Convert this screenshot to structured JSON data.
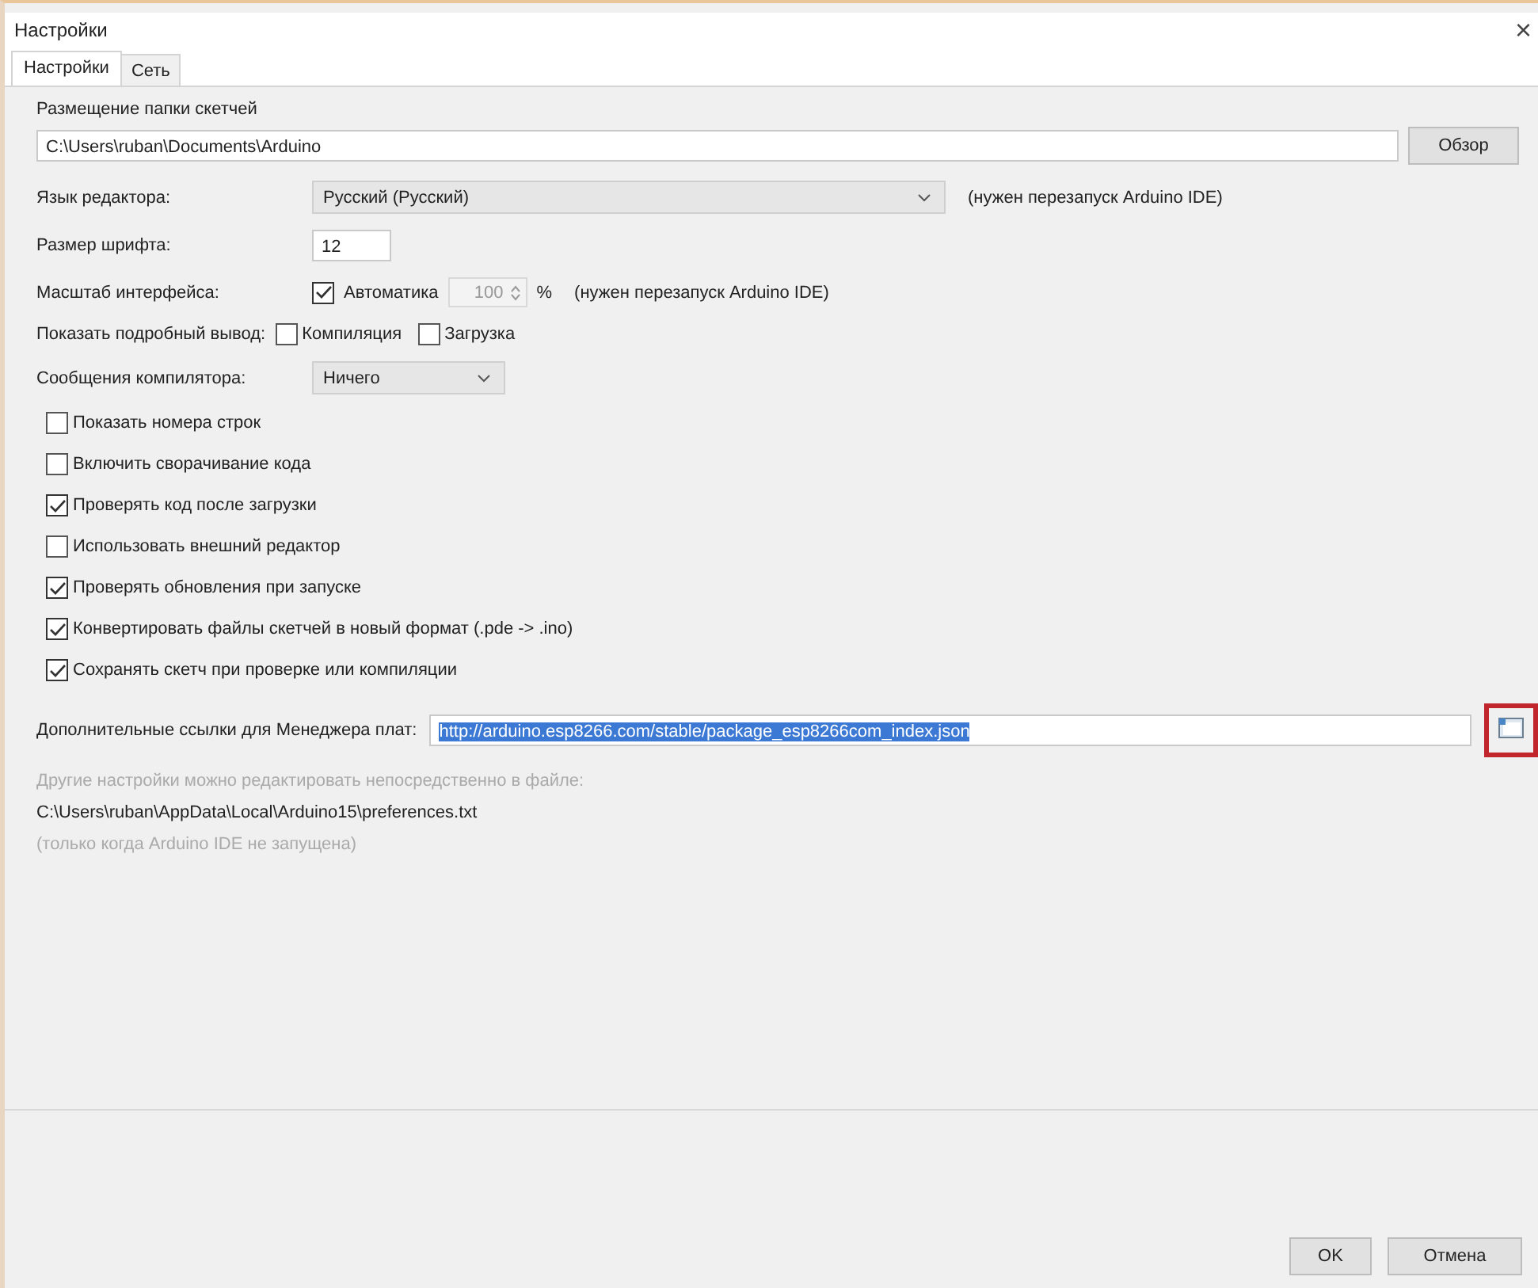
{
  "window": {
    "title": "Настройки",
    "close": "×"
  },
  "tabs": [
    {
      "label": "Настройки",
      "selected": true
    },
    {
      "label": "Сеть",
      "selected": false
    }
  ],
  "sketchbook": {
    "label": "Размещение папки скетчей",
    "value": "C:\\Users\\ruban\\Documents\\Arduino",
    "button": "Обзор"
  },
  "editor_language": {
    "label": "Язык редактора:",
    "value": "Русский (Русский)",
    "note": "(нужен перезапуск Arduino IDE)"
  },
  "font_size": {
    "label": "Размер шрифта:",
    "value": "12"
  },
  "interface_scale": {
    "label": "Масштаб интерфейса:",
    "auto_label": "Автоматика",
    "auto_checked": true,
    "value": "100",
    "unit": "%",
    "note": "(нужен перезапуск Arduino IDE)"
  },
  "verbose_output": {
    "label": "Показать подробный вывод:",
    "options": [
      {
        "label": "Компиляция",
        "checked": false
      },
      {
        "label": "Загрузка",
        "checked": false
      }
    ]
  },
  "compiler_warnings": {
    "label": "Сообщения компилятора:",
    "value": "Ничего"
  },
  "options": [
    {
      "label": "Показать номера строк",
      "checked": false
    },
    {
      "label": "Включить сворачивание кода",
      "checked": false
    },
    {
      "label": "Проверять код после загрузки",
      "checked": true
    },
    {
      "label": "Использовать внешний редактор",
      "checked": false
    },
    {
      "label": "Проверять обновления при запуске",
      "checked": true
    },
    {
      "label": "Конвертировать файлы скетчей в новый формат (.pde -> .ino)",
      "checked": true
    },
    {
      "label": "Сохранять скетч при проверке или компиляции",
      "checked": true
    }
  ],
  "board_urls": {
    "label": "Дополнительные ссылки для Менеджера плат:",
    "value": "http://arduino.esp8266.com/stable/package_esp8266com_index.json",
    "text_selected": true,
    "button_highlighted": true
  },
  "file_note": {
    "hint": "Другие настройки можно редактировать непосредственно в файле:",
    "path": "C:\\Users\\ruban\\AppData\\Local\\Arduino15\\preferences.txt",
    "warning": "(только когда Arduino IDE не запущена)"
  },
  "buttons": [
    "OK",
    "Отмена"
  ]
}
